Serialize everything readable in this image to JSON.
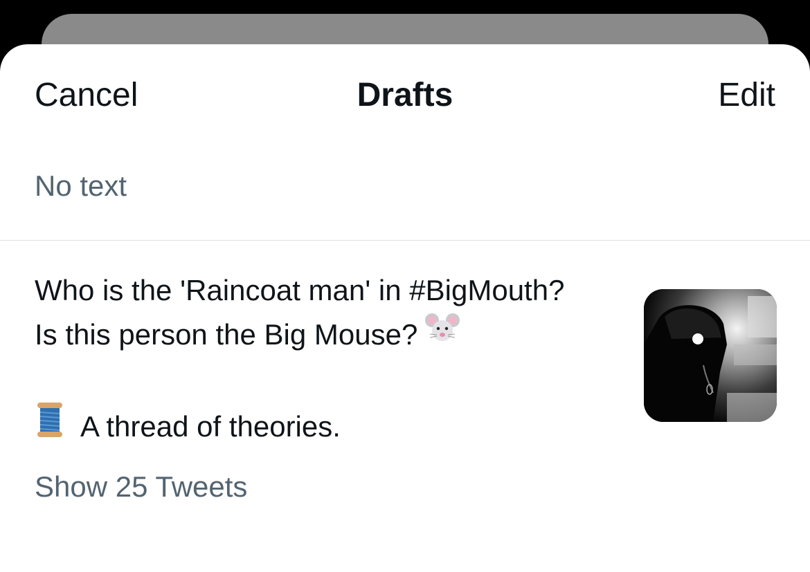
{
  "nav": {
    "cancel_label": "Cancel",
    "title": "Drafts",
    "edit_label": "Edit"
  },
  "drafts": [
    {
      "preview": "No text"
    },
    {
      "lines": [
        "Who is the 'Raincoat man' in #BigMouth?",
        "Is this person the Big Mouse?",
        "A thread of theories."
      ],
      "emoji": [
        "mouse-face-icon",
        "spool-of-thread-icon"
      ],
      "thumbnail": "raincoat-man-image",
      "show_thread_label": "Show 25 Tweets"
    }
  ],
  "colors": {
    "text_primary": "#0f1419",
    "text_secondary": "#536471",
    "background": "#ffffff",
    "divider": "#dcdfe2"
  }
}
